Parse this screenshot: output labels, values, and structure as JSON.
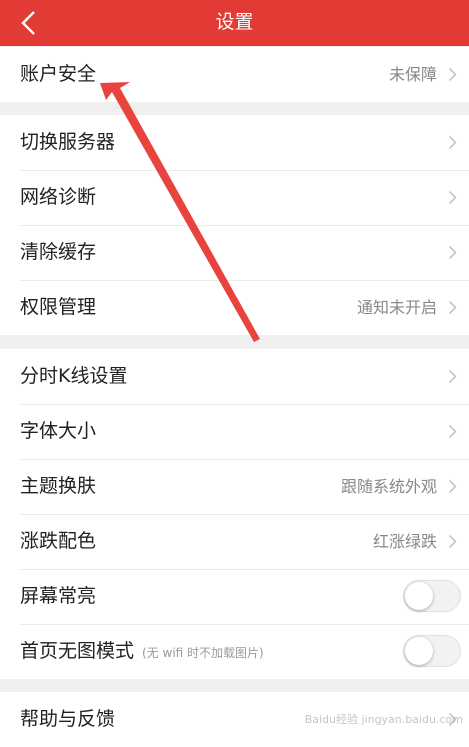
{
  "header": {
    "title": "设置"
  },
  "sections": [
    [
      {
        "label": "账户安全",
        "value": "未保障"
      }
    ],
    [
      {
        "label": "切换服务器"
      },
      {
        "label": "网络诊断"
      },
      {
        "label": "清除缓存"
      },
      {
        "label": "权限管理",
        "value": "通知未开启"
      }
    ],
    [
      {
        "label": "分时K线设置"
      },
      {
        "label": "字体大小"
      },
      {
        "label": "主题换肤",
        "value": "跟随系统外观"
      },
      {
        "label": "涨跌配色",
        "value": "红涨绿跌"
      },
      {
        "label": "屏幕常亮",
        "toggle": false
      },
      {
        "label": "首页无图模式",
        "note": "(无 wifi 时不加载图片)",
        "toggle": false
      }
    ],
    [
      {
        "label": "帮助与反馈"
      }
    ]
  ],
  "watermark": "Baidu经验 jingyan.baidu.com",
  "colors": {
    "accent": "#e23a34",
    "arrow": "#e8433c"
  }
}
